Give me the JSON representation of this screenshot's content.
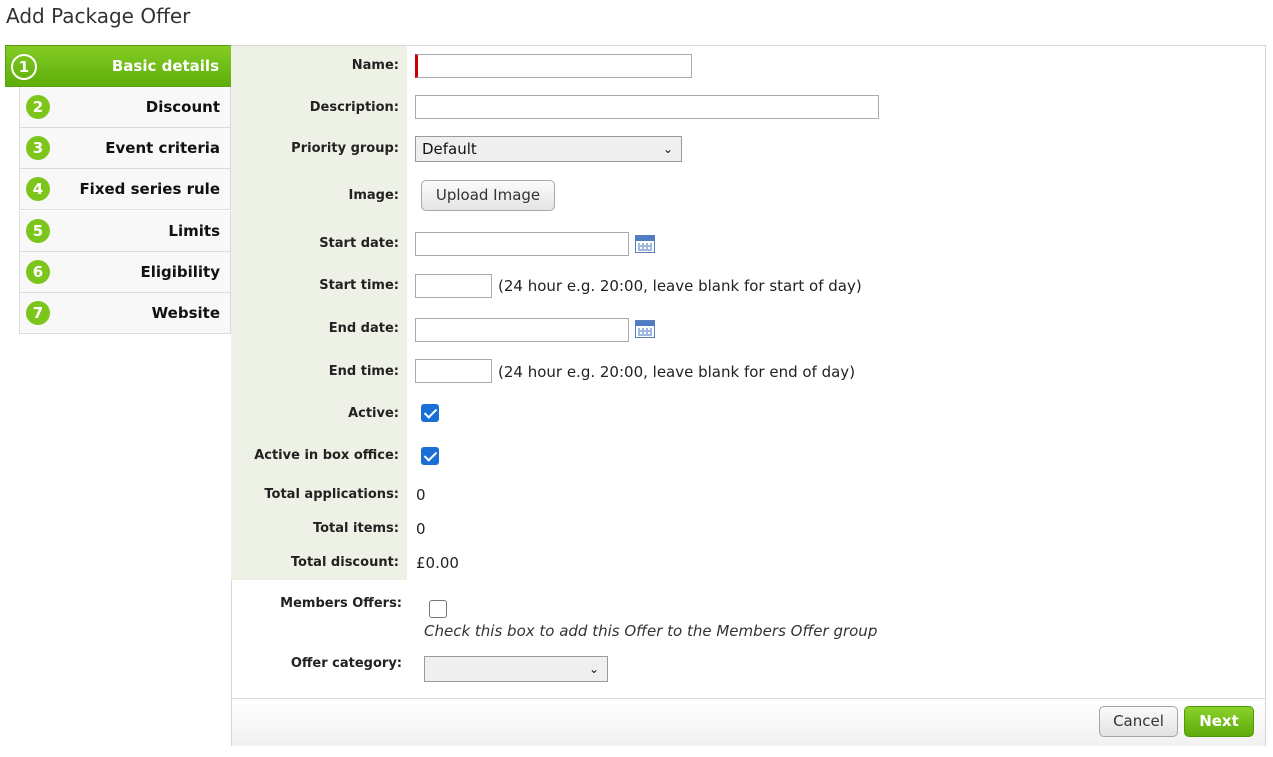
{
  "page": {
    "title": "Add Package Offer"
  },
  "steps": [
    {
      "number": "1",
      "label": "Basic details",
      "active": true
    },
    {
      "number": "2",
      "label": "Discount"
    },
    {
      "number": "3",
      "label": "Event criteria"
    },
    {
      "number": "4",
      "label": "Fixed series rule"
    },
    {
      "number": "5",
      "label": "Limits"
    },
    {
      "number": "6",
      "label": "Eligibility"
    },
    {
      "number": "7",
      "label": "Website"
    }
  ],
  "form": {
    "name": {
      "label": "Name:",
      "value": ""
    },
    "description": {
      "label": "Description:",
      "value": ""
    },
    "priority_group": {
      "label": "Priority group:",
      "selected": "Default"
    },
    "image": {
      "label": "Image:",
      "button": "Upload Image"
    },
    "start_date": {
      "label": "Start date:",
      "value": ""
    },
    "start_time": {
      "label": "Start time:",
      "value": "",
      "hint": "(24 hour e.g. 20:00, leave blank for start of day)"
    },
    "end_date": {
      "label": "End date:",
      "value": ""
    },
    "end_time": {
      "label": "End time:",
      "value": "",
      "hint": "(24 hour e.g. 20:00, leave blank for end of day)"
    },
    "active": {
      "label": "Active:",
      "checked": true
    },
    "active_box_office": {
      "label": "Active in box office:",
      "checked": true
    },
    "total_applications": {
      "label": "Total applications:",
      "value": "0"
    },
    "total_items": {
      "label": "Total items:",
      "value": "0"
    },
    "total_discount": {
      "label": "Total discount:",
      "value": "£0.00"
    },
    "members_offers": {
      "label": "Members Offers:",
      "checked": false,
      "note": "Check this box to add this Offer to the Members Offer group"
    },
    "offer_category": {
      "label": "Offer category:",
      "selected": ""
    }
  },
  "footer": {
    "cancel_label": "Cancel",
    "next_label": "Next"
  },
  "colors": {
    "accent_green": "#6cbb14",
    "required_marker": "#d00000",
    "checkbox_blue": "#1a6fd6",
    "label_panel_bg": "#eef2e6"
  },
  "icons": {
    "calendar": "calendar-icon",
    "dropdown": "chevron-down-icon"
  }
}
